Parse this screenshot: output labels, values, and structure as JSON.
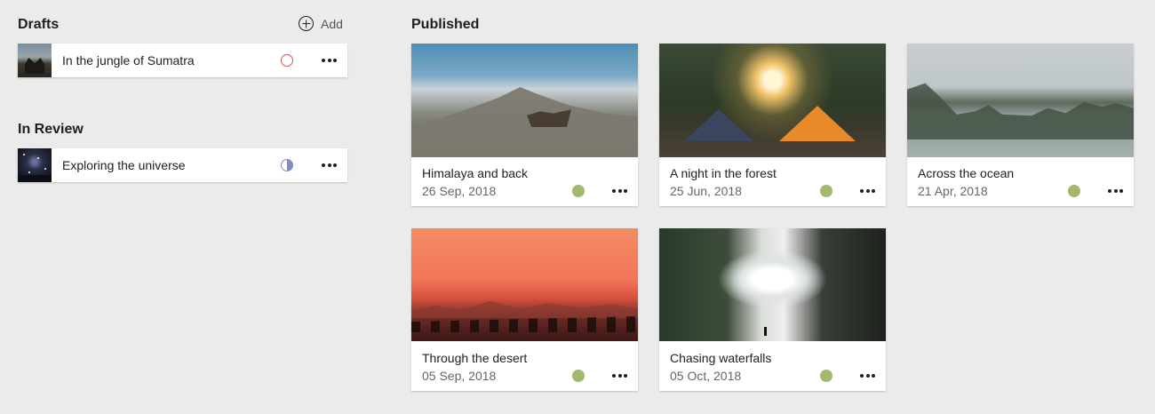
{
  "drafts": {
    "heading": "Drafts",
    "add_label": "Add",
    "items": [
      {
        "title": "In the jungle of Sumatra",
        "status": "draft"
      }
    ]
  },
  "in_review": {
    "heading": "In Review",
    "items": [
      {
        "title": "Exploring the universe",
        "status": "in-review"
      }
    ]
  },
  "published": {
    "heading": "Published",
    "items": [
      {
        "title": "Himalaya and back",
        "date": "26 Sep, 2018"
      },
      {
        "title": "A night in the forest",
        "date": "25 Jun, 2018"
      },
      {
        "title": "Across the ocean",
        "date": "21 Apr, 2018"
      },
      {
        "title": "Through the desert",
        "date": "05 Sep, 2018"
      },
      {
        "title": "Chasing waterfalls",
        "date": "05 Oct, 2018"
      }
    ]
  },
  "colors": {
    "background": "#ebebeb",
    "draft_status": "#d9534f",
    "review_status": "#7d8fb8",
    "published_status": "#a3b86c"
  },
  "icons": {
    "add": "plus-circle-icon",
    "more": "more-horizontal-icon",
    "draft_status": "circle-outline-icon",
    "review_status": "half-circle-icon",
    "published_status": "filled-circle-icon"
  }
}
